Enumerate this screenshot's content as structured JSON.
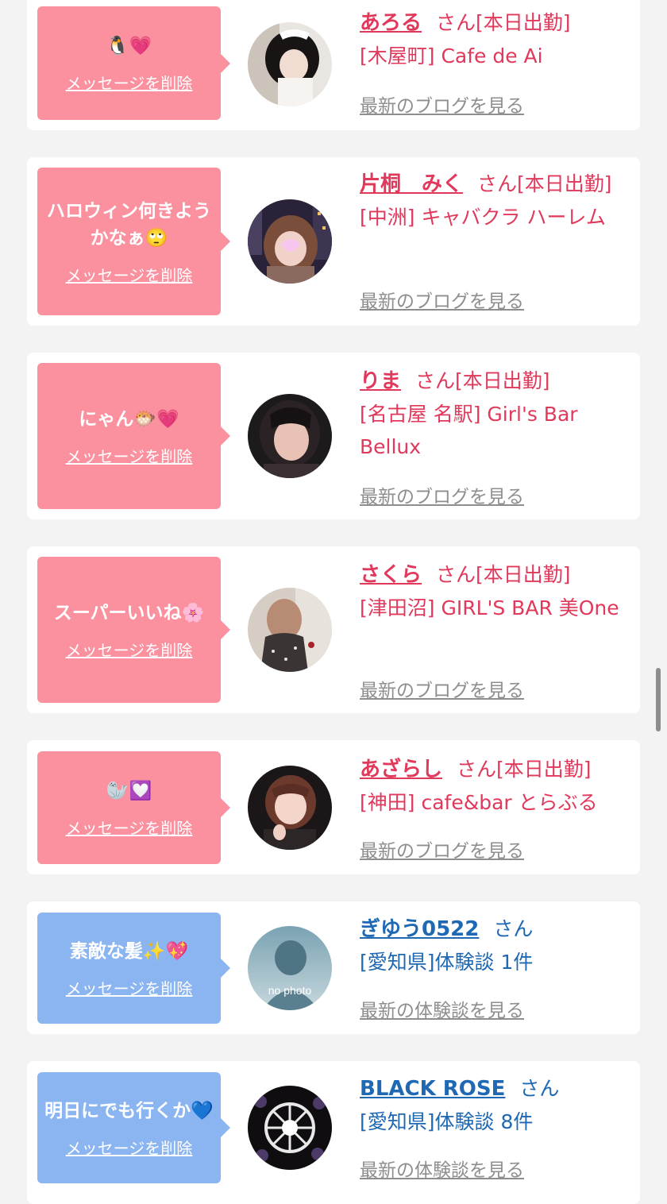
{
  "delete_label": "メッセージを削除",
  "colors": {
    "pink_bubble": "#fb919f",
    "blue_bubble": "#8ab5f1",
    "pink_text": "#e0395b",
    "blue_text": "#1f68b4",
    "link_gray": "#8e8e8e",
    "background": "#f3f3f3"
  },
  "items": [
    {
      "message": "🐧💗",
      "name": "あろる",
      "honorific": "さん",
      "status": "[本日出勤]",
      "shop": "[木屋町] Cafe de Ai",
      "link": "最新のブログを見る"
    },
    {
      "message": "ハロウィン何きようかなぁ🙄",
      "name": "片桐　みく",
      "honorific": "さん",
      "status": "[本日出勤]",
      "shop": "[中洲] キャバクラ ハーレム",
      "link": "最新のブログを見る"
    },
    {
      "message": "にゃん🐡💗",
      "name": "りま",
      "honorific": "さん",
      "status": "[本日出勤]",
      "shop": "[名古屋 名駅] Girl's Bar Bellux",
      "link": "最新のブログを見る"
    },
    {
      "message": "スーパーいいね🌸",
      "name": "さくら",
      "honorific": "さん",
      "status": "[本日出勤]",
      "shop": "[津田沼] GIRL'S BAR 美One",
      "link": "最新のブログを見る"
    },
    {
      "message": "🦭💟",
      "name": "あざらし",
      "honorific": "さん",
      "status": "[本日出勤]",
      "shop": "[神田] cafe&bar とらぶる",
      "link": "最新のブログを見る"
    },
    {
      "message": "素敵な髪✨💖",
      "name": "ぎゆう0522",
      "honorific": "さん",
      "status": "",
      "shop": "[愛知県]体験談 1件",
      "link": "最新の体験談を見る",
      "avatar_text": "no photo"
    },
    {
      "message": "明日にでも行くか💙",
      "name": "BLACK ROSE",
      "honorific": "さん",
      "status": "",
      "shop": "[愛知県]体験談 8件",
      "link": "最新の体験談を見る"
    }
  ]
}
